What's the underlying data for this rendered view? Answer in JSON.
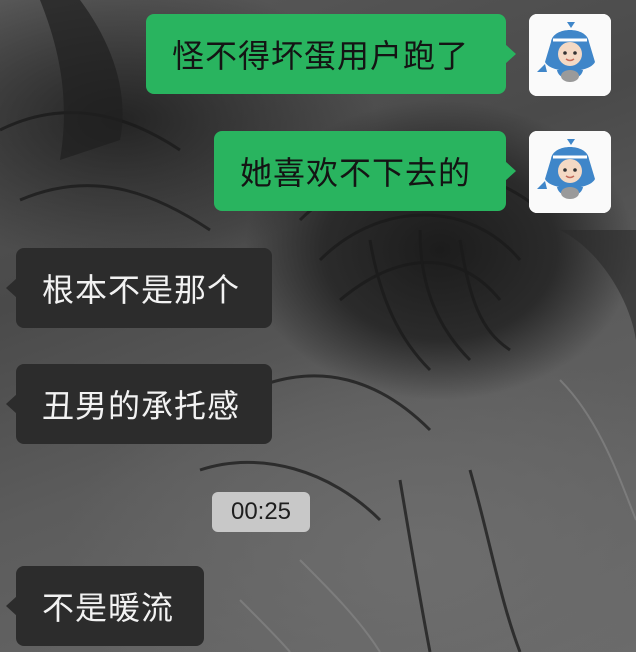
{
  "chat": {
    "messages": [
      {
        "direction": "outgoing",
        "text": "怪不得坏蛋用户跑了",
        "avatar_icon": "shark-hood-avatar-icon"
      },
      {
        "direction": "outgoing",
        "text": "她喜欢不下去的",
        "avatar_icon": "shark-hood-avatar-icon"
      },
      {
        "direction": "incoming",
        "text": "根本不是那个"
      },
      {
        "direction": "incoming",
        "text": "丑男的承托感"
      },
      {
        "direction": "timestamp",
        "text": "00:25"
      },
      {
        "direction": "incoming",
        "text": "不是暖流"
      }
    ]
  },
  "colors": {
    "outgoing_bubble": "#29b45f",
    "incoming_bubble": "#2c2c2c",
    "timestamp_pill": "#c8c8c8"
  }
}
